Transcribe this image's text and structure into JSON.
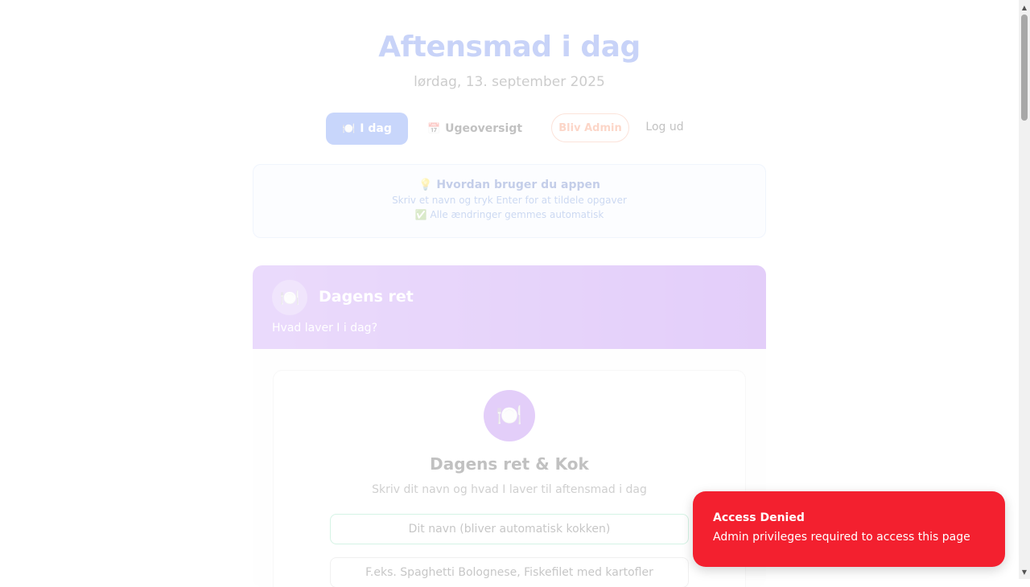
{
  "header": {
    "title": "Aftensmad i dag",
    "date": "lørdag, 13. september 2025"
  },
  "nav": {
    "today": {
      "icon": "🍽️",
      "label": "I dag"
    },
    "week": {
      "icon": "📅",
      "label": "Ugeoversigt"
    },
    "admin_label": "Bliv Admin",
    "logout_label": "Log ud"
  },
  "info": {
    "icon": "💡",
    "title": "Hvordan bruger du appen",
    "line1": "Skriv et navn og tryk Enter for at tildele opgaver",
    "line2": "✅ Alle ændringer gemmes automatisk"
  },
  "card": {
    "icon": "🍽️",
    "title": "Dagens ret",
    "subtitle": "Hvad laver I i dag?",
    "inner": {
      "icon": "🍽️",
      "title": "Dagens ret & Kok",
      "subtitle": "Skriv dit navn og hvad I laver til aftensmad i dag",
      "name_placeholder": "Dit navn (bliver automatisk kokken)",
      "dish_placeholder": "F.eks. Spaghetti Bolognese, Fiskefilet med kartofler"
    }
  },
  "toast": {
    "title": "Access Denied",
    "message": "Admin privileges required to access this page",
    "color": "#f3202f"
  },
  "colors": {
    "accent": "#3b6bf0",
    "purple": "#9b50ea",
    "admin": "#f26b3a"
  }
}
